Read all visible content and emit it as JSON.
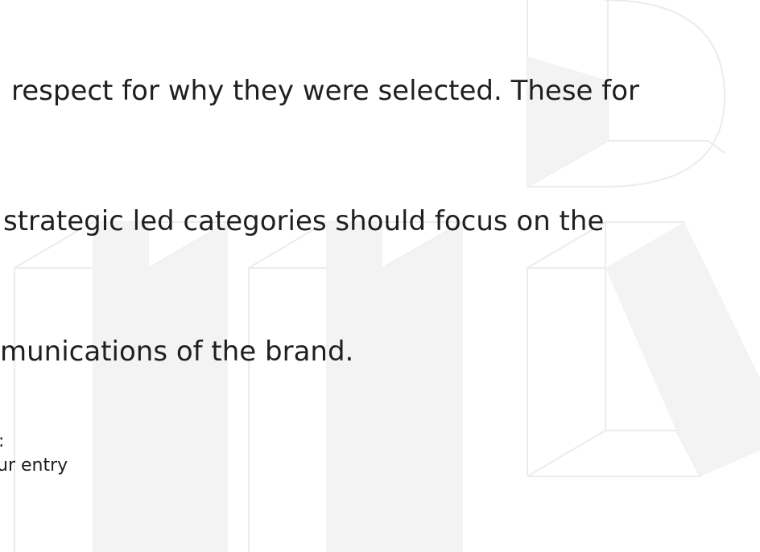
{
  "text": {
    "line1": "respect for why they were selected. These for",
    "line2": "strategic led categories should focus on the",
    "line3": "munications of the brand."
  },
  "note": {
    "colon": ":",
    "entry": "ur entry"
  },
  "colors": {
    "text": "#1f1f1f",
    "shape_fill": "#f3f3f3",
    "shape_stroke": "#ececec"
  }
}
